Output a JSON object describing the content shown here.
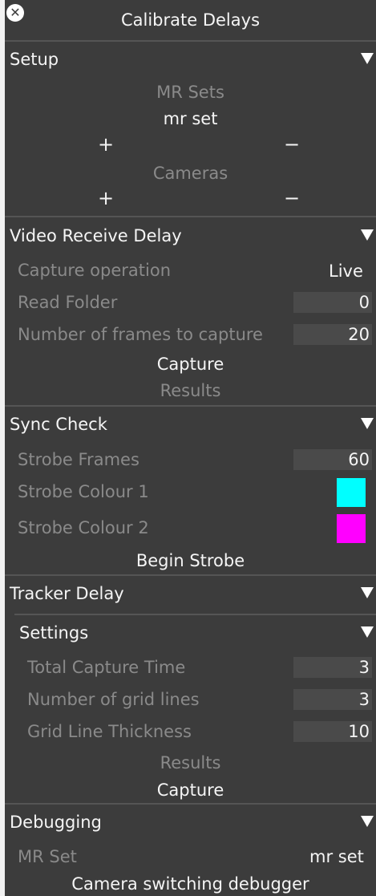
{
  "window": {
    "title": "Calibrate Delays",
    "close_icon": "close-icon"
  },
  "setup": {
    "title": "Setup",
    "mr_sets_label": "MR Sets",
    "mr_set_item": "mr set",
    "mr_add": "+",
    "mr_remove": "−",
    "cameras_label": "Cameras",
    "cam_add": "+",
    "cam_remove": "−"
  },
  "video": {
    "title": "Video Receive Delay",
    "capture_operation_label": "Capture operation",
    "capture_operation_value": "Live",
    "read_folder_label": "Read Folder",
    "read_folder_value": "0",
    "frames_label": "Number of frames to capture",
    "frames_value": "20",
    "capture_button": "Capture",
    "results_label": "Results"
  },
  "sync": {
    "title": "Sync Check",
    "strobe_frames_label": "Strobe Frames",
    "strobe_frames_value": "60",
    "colour1_label": "Strobe Colour 1",
    "colour1": "#00ffff",
    "colour2_label": "Strobe Colour 2",
    "colour2": "#ff00ff",
    "begin_button": "Begin Strobe"
  },
  "tracker": {
    "title": "Tracker Delay",
    "settings_title": "Settings",
    "total_time_label": "Total Capture Time",
    "total_time_value": "3",
    "grid_lines_label": "Number of grid lines",
    "grid_lines_value": "3",
    "thickness_label": "Grid Line Thickness",
    "thickness_value": "10",
    "results_label": "Results",
    "capture_button": "Capture"
  },
  "debugging": {
    "title": "Debugging",
    "mr_set_label": "MR Set",
    "mr_set_value": "mr set",
    "switch_button": "Camera switching debugger"
  },
  "colors": {
    "panel_bg": "#3c3c3c",
    "field_bg": "#4a4a4a",
    "text": "#f5f5f5",
    "dim_text": "#8a8a8a"
  }
}
